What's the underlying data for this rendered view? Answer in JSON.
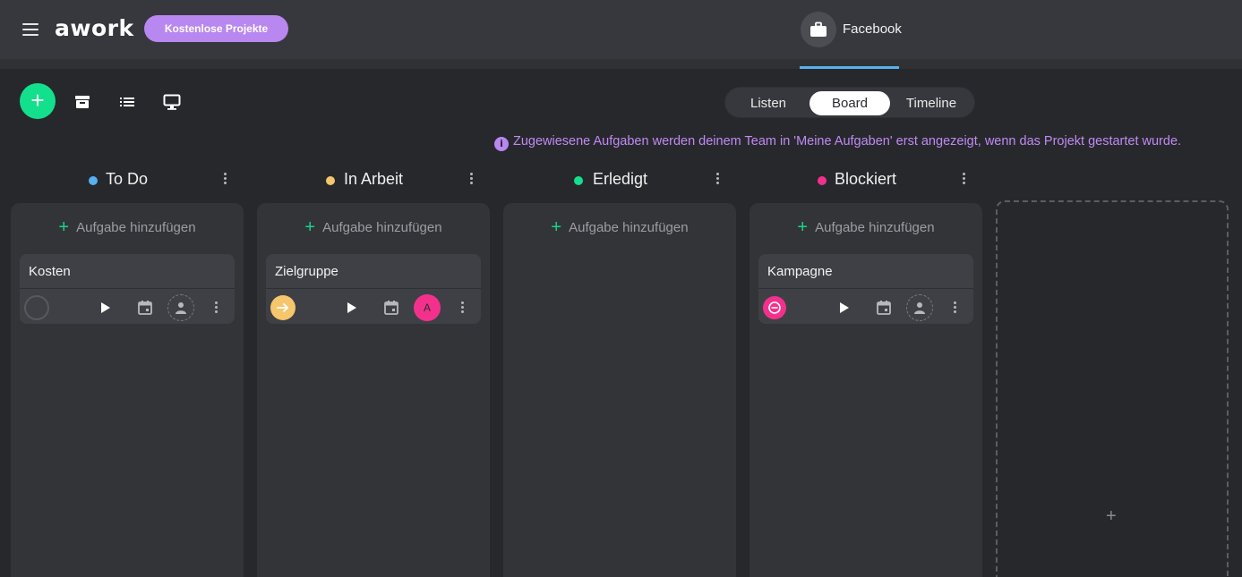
{
  "header": {
    "logo": "awork",
    "promo_button": "Kostenlose Projekte",
    "project_name": "Facebook"
  },
  "view_switch": {
    "options": [
      "Listen",
      "Board",
      "Timeline"
    ],
    "active": "Board"
  },
  "info_message": "Zugewiesene Aufgaben werden deinem Team in 'Meine Aufgaben' erst angezeigt, wenn das Projekt gestartet wurde.",
  "add_task_label": "Aufgabe hinzufügen",
  "columns": [
    {
      "title": "To Do",
      "color": "#56b1ef",
      "task": {
        "title": "Kosten",
        "status": "todo",
        "assignee_initial": ""
      }
    },
    {
      "title": "In Arbeit",
      "color": "#f5c66b",
      "task": {
        "title": "Zielgruppe",
        "status": "in-progress",
        "assignee_initial": "A"
      }
    },
    {
      "title": "Erledigt",
      "color": "#13e08c",
      "task": null
    },
    {
      "title": "Blockiert",
      "color": "#f3318d",
      "task": {
        "title": "Kampagne",
        "status": "blocked",
        "assignee_initial": ""
      }
    }
  ],
  "colors": {
    "accent_green": "#13e08c",
    "accent_purple": "#b887f0",
    "tab_underline": "#56b1ef"
  }
}
